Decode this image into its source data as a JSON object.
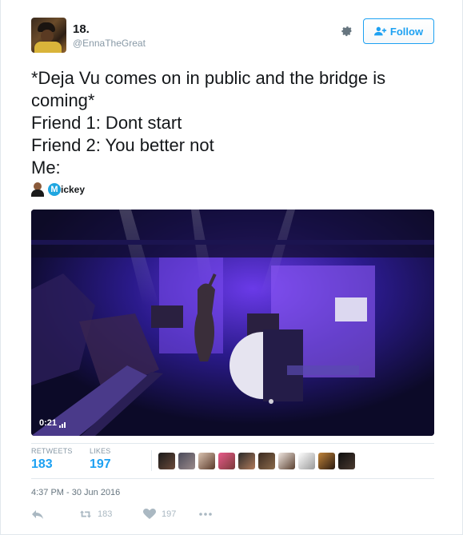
{
  "user": {
    "name": "18.",
    "handle": "@EnnaTheGreat"
  },
  "header": {
    "follow_label": "Follow"
  },
  "tweet": {
    "lines": [
      "*Deja Vu comes on in public and the bridge is coming*",
      "Friend 1: Dont start",
      "Friend 2: You better not",
      "Me:"
    ],
    "mention_name": "ickey",
    "mention_letter": "M"
  },
  "video": {
    "timecode": "0:21"
  },
  "stats": {
    "retweets_label": "RETWEETS",
    "retweets_count": "183",
    "likes_label": "LIKES",
    "likes_count": "197"
  },
  "timestamp": "4:37 PM - 30 Jun 2016",
  "actions": {
    "retweet_count": "183",
    "like_count": "197"
  },
  "colors": {
    "accent": "#1da1f2",
    "muted": "#8899a6"
  }
}
